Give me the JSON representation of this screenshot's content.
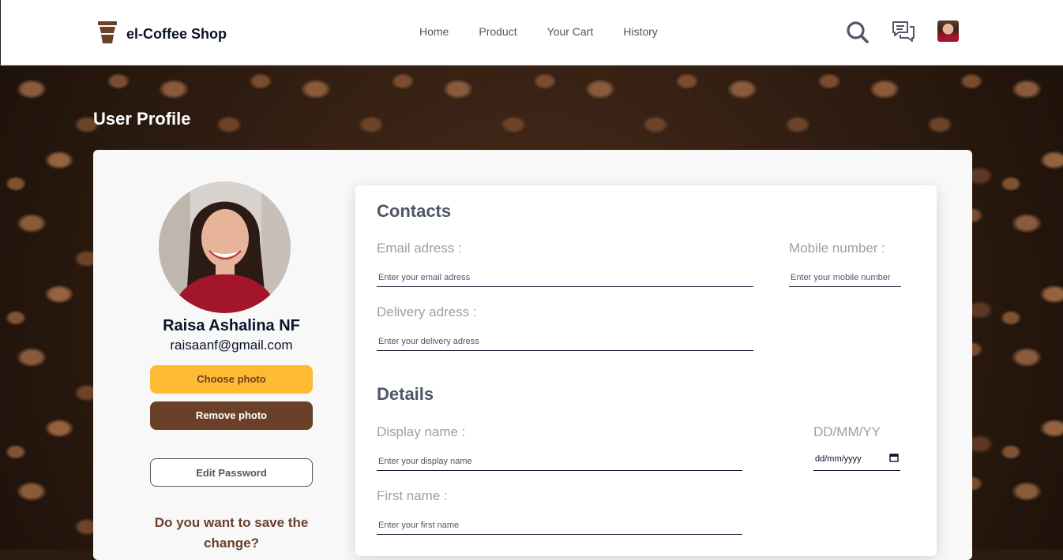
{
  "navbar": {
    "brand": "el-Coffee Shop",
    "links": [
      "Home",
      "Product",
      "Your Cart",
      "History"
    ],
    "icons": [
      "coffee-cup-icon",
      "search-icon",
      "chat-icon",
      "user-avatar"
    ]
  },
  "page": {
    "title": "User Profile"
  },
  "profile": {
    "name": "Raisa Ashalina NF",
    "email": "raisaanf@gmail.com",
    "choose_photo": "Choose photo",
    "remove_photo": "Remove photo",
    "edit_password": "Edit Password",
    "save_question": "Do you want to save the change?"
  },
  "contacts": {
    "title": "Contacts",
    "email_label": "Email adress :",
    "email_placeholder": "Enter your email adress",
    "mobile_label": "Mobile number :",
    "mobile_placeholder": "Enter your mobile number",
    "delivery_label": "Delivery adress :",
    "delivery_placeholder": "Enter your delivery adress"
  },
  "details": {
    "title": "Details",
    "display_label": "Display name :",
    "display_placeholder": "Enter your display name",
    "date_label": "DD/MM/YY",
    "date_placeholder": "dd/mm/yyyy",
    "first_label": "First name :",
    "first_placeholder": "Enter your first name"
  },
  "colors": {
    "primary_yellow": "#ffba33",
    "primary_brown": "#6a4029",
    "text_dark": "#0b132a",
    "text_gray": "#4f5665"
  }
}
